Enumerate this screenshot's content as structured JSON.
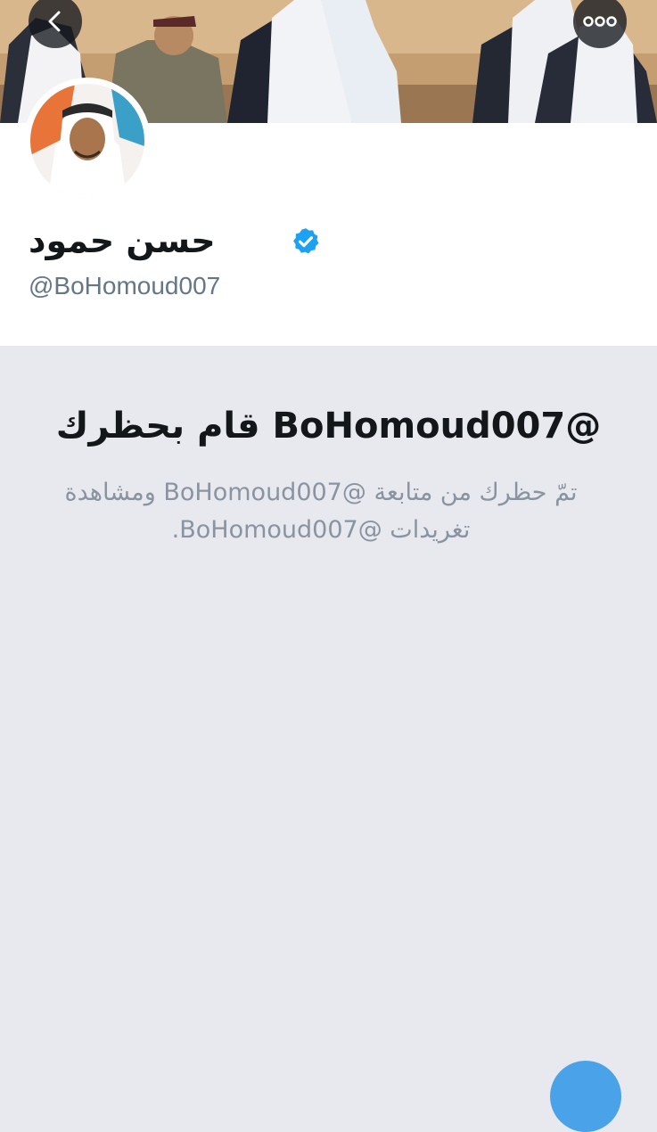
{
  "colors": {
    "accent": "#1da1f2",
    "verified_badge": "#1da1f2",
    "handle_text": "#657786",
    "page_background": "#e7e9ef"
  },
  "nav": {
    "back_icon": "chevron-left-icon",
    "more_icon": "ellipsis-icon"
  },
  "profile": {
    "display_name": "حسن حمود",
    "handle": "@BoHomoud007",
    "verified_icon": "verified-badge-icon",
    "avatar_icon": "profile-photo"
  },
  "blocked": {
    "title": "@BoHomoud007 قام بحظرك",
    "description": "تمّ حظرك من متابعة @BoHomoud007 ومشاهدة تغريدات @BoHomoud007."
  }
}
